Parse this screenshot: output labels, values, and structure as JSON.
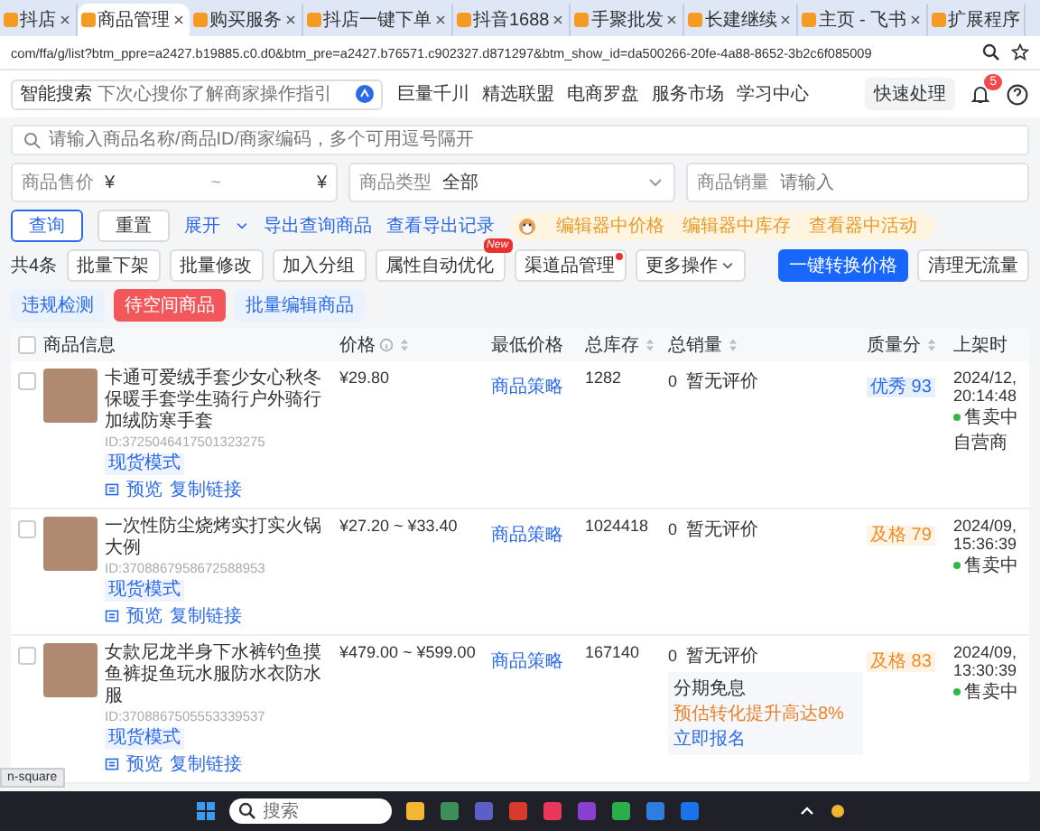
{
  "browser": {
    "tabs": [
      {
        "title": "抖店",
        "selected": false,
        "closable": true
      },
      {
        "title": "商品管理",
        "selected": true,
        "closable": true
      },
      {
        "title": "购买服务",
        "selected": false,
        "closable": true
      },
      {
        "title": "抖店一键下单",
        "selected": false,
        "closable": true
      },
      {
        "title": "抖音1688",
        "selected": false,
        "closable": true
      },
      {
        "title": "手聚批发",
        "selected": false,
        "closable": true
      },
      {
        "title": "长建继续",
        "selected": false,
        "closable": true
      },
      {
        "title": "主页 - 飞书",
        "selected": false,
        "closable": true
      },
      {
        "title": "扩展程序",
        "selected": false,
        "closable": false
      }
    ],
    "url": "com/ffa/g/list?btm_ppre=a2427.b19885.c0.d0&btm_pre=a2427.b76571.c902327.d871297&btm_show_id=da500266-20fe-4a88-8652-3b2c6f085009"
  },
  "header": {
    "search": {
      "label": "智能搜索",
      "placeholder": "下次心搜你了解商家操作指引"
    },
    "nav": [
      "巨量千川",
      "精选联盟",
      "电商罗盘",
      "服务市场",
      "学习中心"
    ],
    "quick_action": "快速处理",
    "notification_count": "5"
  },
  "search": {
    "placeholder": "请输入商品名称/商品ID/商家编码，多个可用逗号隔开"
  },
  "filters": [
    {
      "kind": "range",
      "label": "商品售价",
      "from": "¥",
      "separator": "~",
      "to": "¥"
    },
    {
      "kind": "select",
      "label": "商品类型",
      "value": "全部"
    },
    {
      "kind": "input",
      "label": "商品销量",
      "placeholder": "请输入"
    }
  ],
  "actions": {
    "query": "查询",
    "reset": "重置",
    "expand": "展开",
    "links": [
      "导出查询商品",
      "查看导出记录"
    ],
    "tips": [
      "编辑器中价格",
      "编辑器中库存",
      "查看器中活动"
    ]
  },
  "toolbar": {
    "count": "共4条",
    "buttons": [
      {
        "label": "批量下架",
        "kind": "default",
        "dot": false
      },
      {
        "label": "批量修改",
        "kind": "default",
        "dot": false
      },
      {
        "label": "加入分组",
        "kind": "default",
        "dot": false
      },
      {
        "label": "属性自动优化",
        "kind": "default",
        "dot": false,
        "badge": "New"
      },
      {
        "label": "渠道品管理",
        "kind": "default",
        "dot": true
      },
      {
        "label": "更多操作",
        "kind": "dropdown",
        "dot": false
      },
      {
        "label": "一键转换价格",
        "kind": "primary",
        "dot": false
      },
      {
        "label": "清理无流量",
        "kind": "default",
        "dot": false
      },
      {
        "label": "违规检测",
        "kind": "light",
        "dot": false
      },
      {
        "label": "待空间商品",
        "kind": "danger",
        "dot": false
      },
      {
        "label": "批量编辑商品",
        "kind": "light",
        "dot": false
      }
    ]
  },
  "table": {
    "select_all": false,
    "columns": [
      {
        "label": "商品信息",
        "sortable": false,
        "info": false
      },
      {
        "label": "价格",
        "sortable": true,
        "info": true
      },
      {
        "label": "最低价格",
        "sortable": false,
        "info": false
      },
      {
        "label": "总库存",
        "sortable": true,
        "info": false
      },
      {
        "label": "总销量",
        "sortable": true,
        "info": false
      },
      {
        "label": "质量分",
        "sortable": true,
        "info": false
      },
      {
        "label": "上架时",
        "sortable": false,
        "info": false
      }
    ],
    "rows": [
      {
        "selected": false,
        "title": "卡通可爱绒手套少女心秋冬保暖手套学生骑行户外骑行加绒防寒手套",
        "id": "ID:3725046417501323275",
        "mode": "现货模式",
        "preview": "预览",
        "copy_link": "复制链接",
        "price": "¥29.80",
        "strategy": "商品策略",
        "stock": "1282",
        "sales": "0",
        "rating": "暂无评价",
        "quality": {
          "label": "优秀 93",
          "kind": "excellent"
        },
        "date": "2024/12,",
        "time": "20:14:48",
        "status": "售卖中",
        "extra": "自营商"
      },
      {
        "selected": false,
        "title": "一次性防尘烧烤实打实火锅大例",
        "id": "ID:3708867958672588953",
        "mode": "现货模式",
        "preview": "预览",
        "copy_link": "复制链接",
        "price": "¥27.20 ~ ¥33.40",
        "strategy": "商品策略",
        "stock": "1024418",
        "sales": "0",
        "rating": "暂无评价",
        "quality": {
          "label": "及格 79",
          "kind": "pass"
        },
        "date": "2024/09,",
        "time": "15:36:39",
        "status": "售卖中"
      },
      {
        "selected": false,
        "title": "女款尼龙半身下水裤钓鱼摸鱼裤捉鱼玩水服防水衣防水服",
        "id": "ID:3708867505553339537",
        "mode": "现货模式",
        "preview": "预览",
        "copy_link": "复制链接",
        "price": "¥479.00 ~ ¥599.00",
        "strategy": "商品策略",
        "stock": "167140",
        "sales": "0",
        "rating": "暂无评价",
        "promo": {
          "title": "分期免息",
          "text": "预估转化提升高达8%",
          "link": "立即报名"
        },
        "quality": {
          "label": "及格 83",
          "kind": "pass"
        },
        "date": "2024/09,",
        "time": "13:30:39",
        "status": "售卖中"
      }
    ]
  },
  "tooltip": "n-square",
  "taskbar": {
    "search_placeholder": "搜索"
  }
}
